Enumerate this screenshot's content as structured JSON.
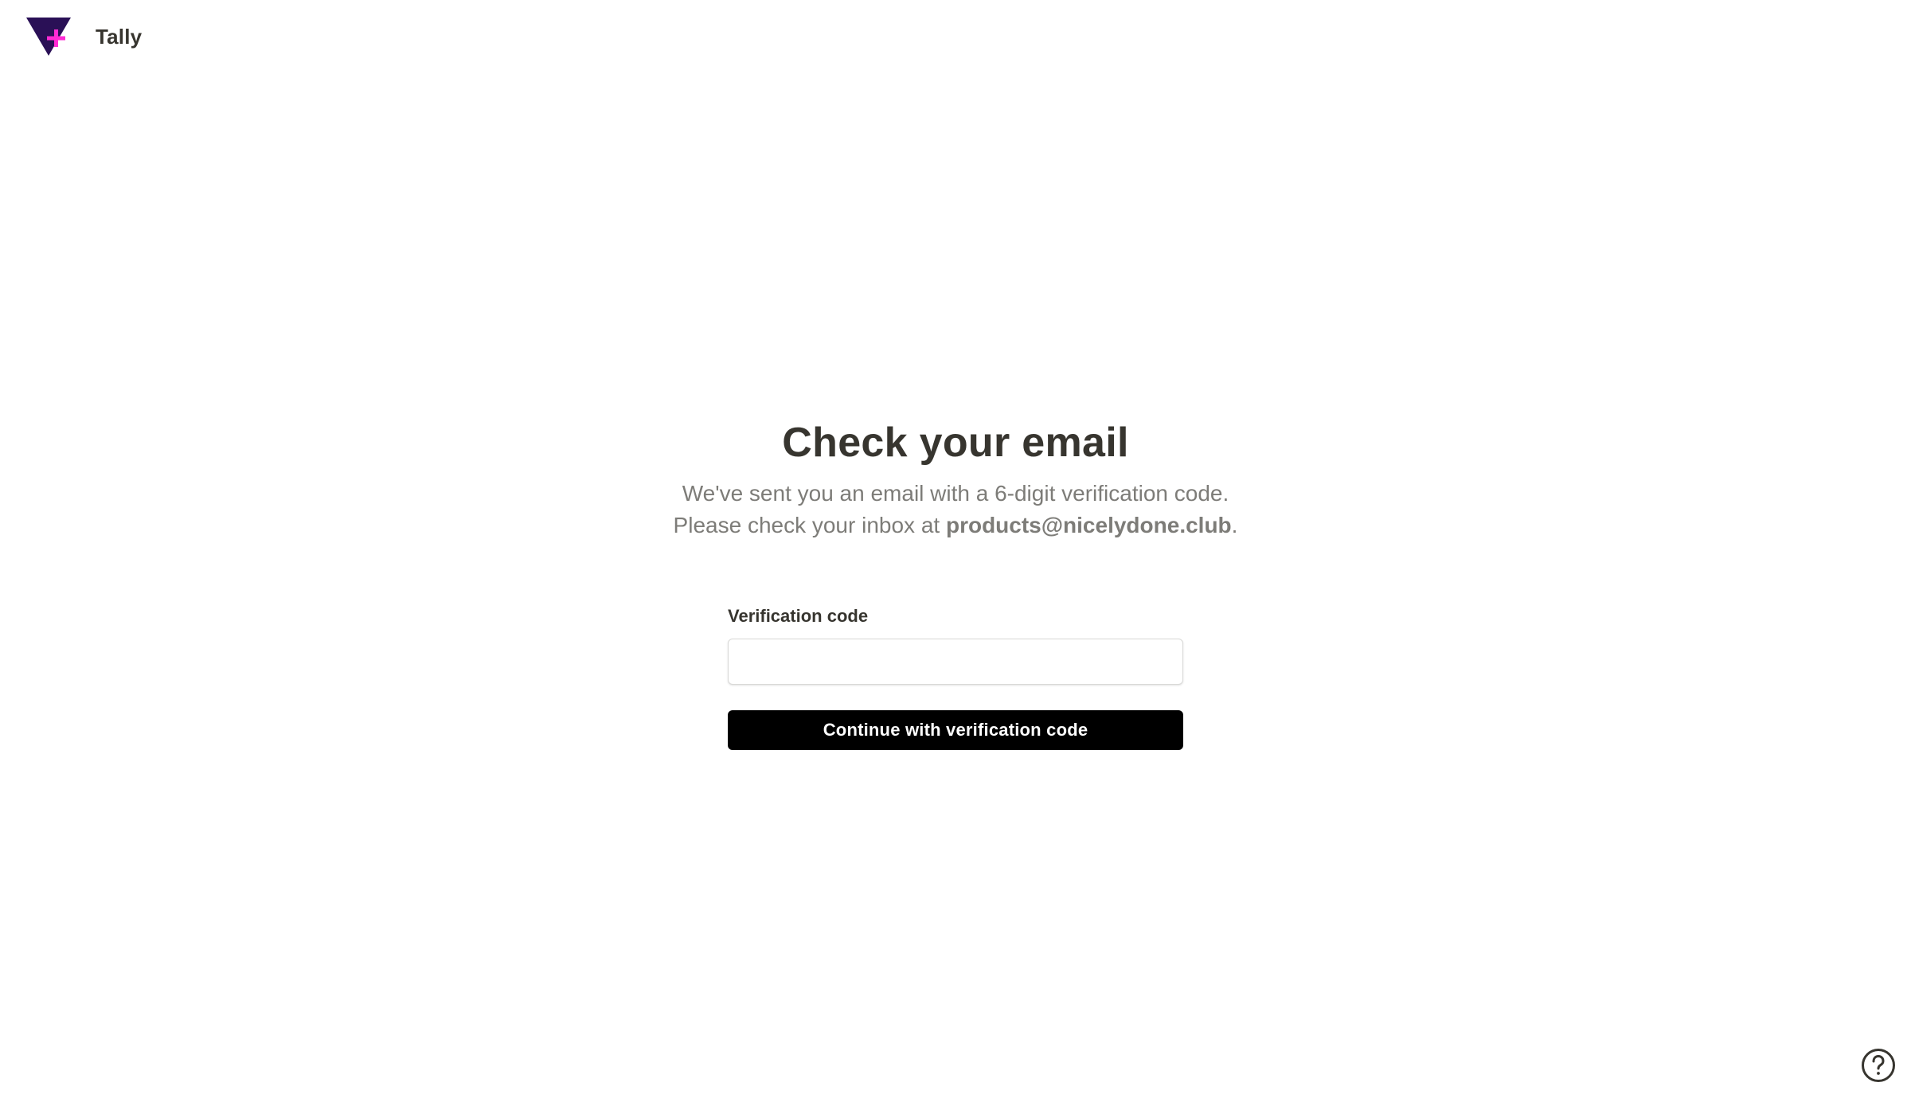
{
  "brand": {
    "name": "Tally",
    "logo_icon": "tally-logo-icon",
    "colors": {
      "triangle": "#2a1056",
      "plus": "#ff2ad4"
    }
  },
  "main": {
    "title": "Check your email",
    "subtitle_line1": "We've sent you an email with a 6-digit verification code.",
    "subtitle_line2_prefix": "Please check your inbox at ",
    "email": "products@nicelydone.club",
    "subtitle_line2_suffix": "."
  },
  "form": {
    "code_label": "Verification code",
    "code_value": "",
    "code_placeholder": "",
    "submit_label": "Continue with verification code"
  },
  "help": {
    "icon": "question-circle-icon"
  },
  "colors": {
    "button_bg": "#000000",
    "button_text": "#ffffff",
    "text_primary": "#37352f",
    "text_secondary": "#7d7c78"
  }
}
